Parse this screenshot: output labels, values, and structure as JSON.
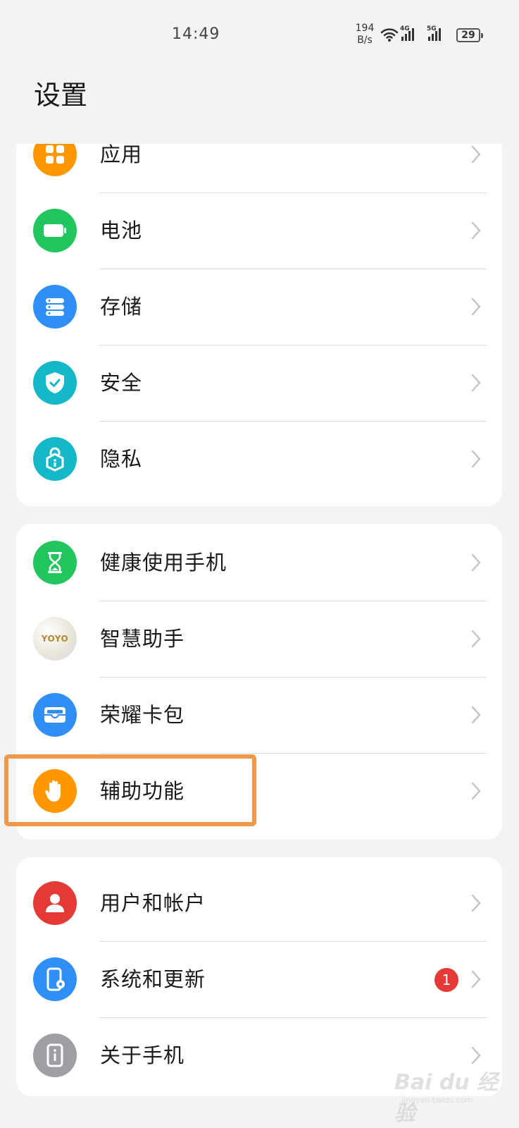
{
  "status_bar": {
    "time": "14:49",
    "net_speed": "194 B/s",
    "sig1_label": "4G",
    "sig2_label": "5G",
    "battery": "29"
  },
  "page_title": "设置",
  "groups": [
    {
      "items": [
        {
          "label": "应用",
          "icon": "apps-icon",
          "color": "#ff9800"
        },
        {
          "label": "电池",
          "icon": "battery-icon",
          "color": "#22c55e"
        },
        {
          "label": "存储",
          "icon": "storage-icon",
          "color": "#2f8ff6"
        },
        {
          "label": "安全",
          "icon": "shield-icon",
          "color": "#14b8c6"
        },
        {
          "label": "隐私",
          "icon": "privacy-lock-icon",
          "color": "#14b8c6"
        }
      ]
    },
    {
      "items": [
        {
          "label": "健康使用手机",
          "icon": "hourglass-icon",
          "color": "#22c55e"
        },
        {
          "label": "智慧助手",
          "icon": "yoyo-assistant-icon",
          "icon_text": "YOYO",
          "color": "#f4f0e6"
        },
        {
          "label": "荣耀卡包",
          "icon": "wallet-icon",
          "color": "#2f8ff6"
        },
        {
          "label": "辅助功能",
          "icon": "hand-icon",
          "color": "#ff9800"
        }
      ]
    },
    {
      "items": [
        {
          "label": "用户和帐户",
          "icon": "user-icon",
          "color": "#e53935"
        },
        {
          "label": "系统和更新",
          "icon": "system-update-icon",
          "color": "#2f8ff6",
          "badge": "1"
        },
        {
          "label": "关于手机",
          "icon": "about-phone-icon",
          "color": "#9e9ea3"
        }
      ]
    }
  ],
  "watermark": {
    "text": "Bai du 经验",
    "sub": "jingyan.baidu.com"
  }
}
